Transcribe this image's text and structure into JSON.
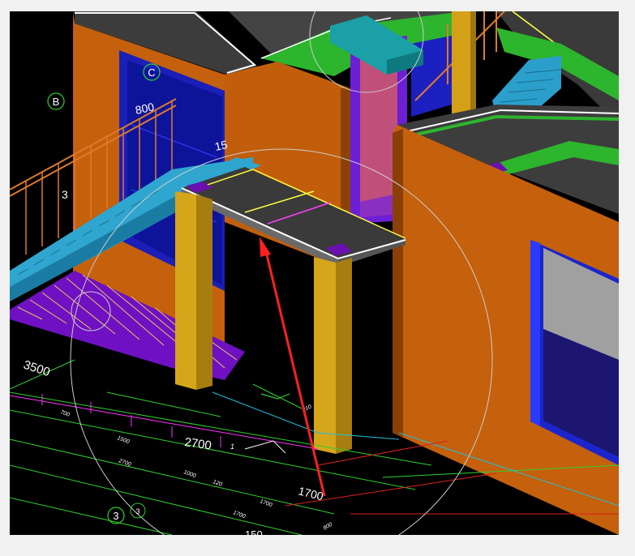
{
  "viewer": {
    "title": "",
    "background": "#000000",
    "frame_color": "#f1f1f1"
  },
  "axes": {
    "c": "C",
    "b": "B",
    "three": "3",
    "three_small": "3"
  },
  "dimensions": {
    "d3500": "3500",
    "d2700": "2700",
    "d1700": "1700",
    "d800": "800",
    "d15": "15",
    "d3": "3",
    "d150": "150",
    "s700": "700",
    "s1500": "1500",
    "s2700": "2700",
    "s1000": "1000",
    "s120": "120",
    "s1700a": "1700",
    "s1700b": "1700",
    "s800": "800",
    "s1": "1",
    "s210": "210"
  },
  "colors": {
    "wall": "#c8620c",
    "wall_dark": "#8a3f06",
    "slab": "#3a3a3a",
    "column": "#d4a017",
    "stair": "#2a9fc8",
    "railing": "#e07a2a",
    "window_glass": "#1e2ad0",
    "floor_green": "#2fae2f",
    "purple": "#6a0fb5",
    "annotation_arrow": "#ff2020"
  }
}
